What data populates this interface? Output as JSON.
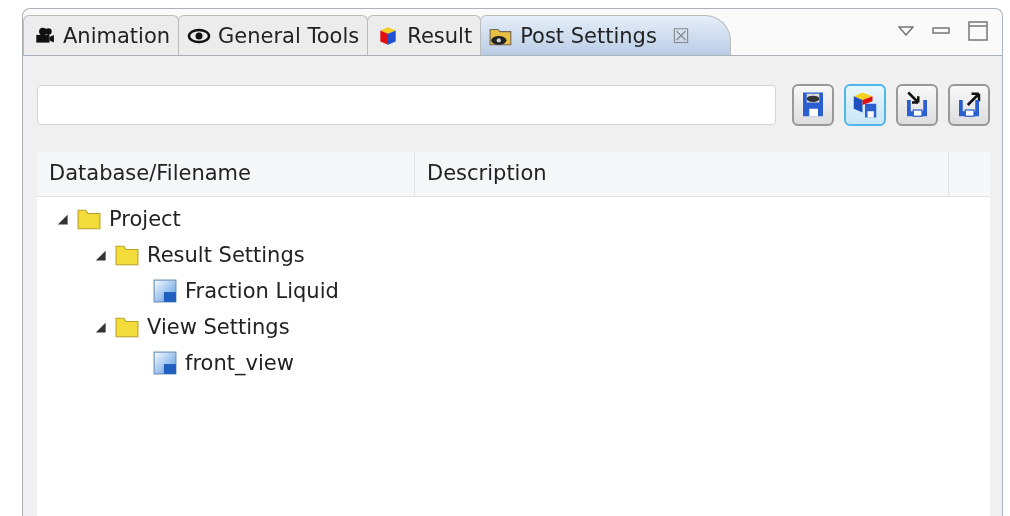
{
  "tabs": [
    {
      "label": "Animation",
      "kind": "camera",
      "selected": false
    },
    {
      "label": "General Tools",
      "kind": "eye",
      "selected": false
    },
    {
      "label": "Result",
      "kind": "cube",
      "selected": false
    },
    {
      "label": "Post Settings",
      "kind": "folder-eye",
      "selected": true,
      "close": "☒"
    }
  ],
  "toolbar": [
    {
      "kind": "save-eye",
      "selected": false
    },
    {
      "kind": "save-cube",
      "selected": true
    },
    {
      "kind": "import",
      "selected": false
    },
    {
      "kind": "export",
      "selected": false
    }
  ],
  "table": {
    "columns": [
      "Database/Filename",
      "Description"
    ],
    "tree": [
      {
        "label": "Project",
        "kind": "folder",
        "expanded": true,
        "children": [
          {
            "label": "Result Settings",
            "kind": "folder",
            "expanded": true,
            "children": [
              {
                "label": "Fraction Liquid",
                "kind": "file"
              }
            ]
          },
          {
            "label": "View Settings",
            "kind": "folder",
            "expanded": true,
            "children": [
              {
                "label": "front_view",
                "kind": "file"
              }
            ]
          }
        ]
      }
    ]
  }
}
